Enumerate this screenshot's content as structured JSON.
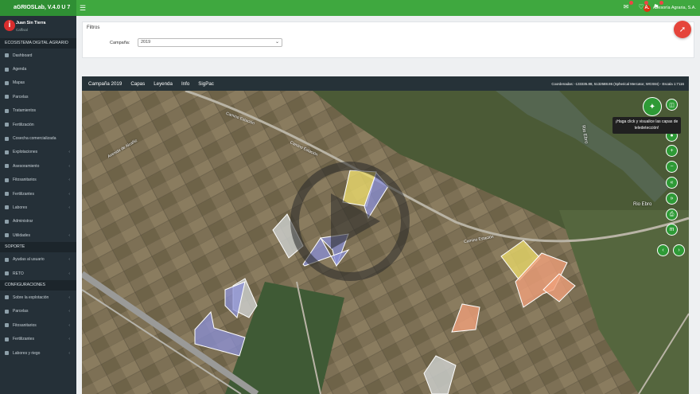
{
  "app": {
    "title": "aGRIOSLab, V.4.0 U 7"
  },
  "topbar": {
    "menu_icon": "hamburger-icon",
    "icons": [
      "mail-icon",
      "bell-icon",
      "flag-icon"
    ],
    "company_logo": "A.",
    "company_name": "Asesoría Agraria, S.A."
  },
  "profile": {
    "name": "Juan Sin Tierra",
    "location": "Caffisal"
  },
  "sidebar": {
    "section1": "ECOSISTEMA DIGITAL AGRARIO",
    "items1": [
      {
        "label": "Dashboard",
        "chev": false
      },
      {
        "label": "Agenda",
        "chev": false
      },
      {
        "label": "Mapas",
        "chev": false
      },
      {
        "label": "Parcelas",
        "chev": false
      },
      {
        "label": "Tratamientos",
        "chev": false
      },
      {
        "label": "Fertilización",
        "chev": false
      },
      {
        "label": "Cosecha comercializada",
        "chev": false
      },
      {
        "label": "Explotaciones",
        "chev": true
      },
      {
        "label": "Asesoramiento",
        "chev": true
      },
      {
        "label": "Fitosanitarios",
        "chev": true
      },
      {
        "label": "Fertilizantes",
        "chev": true
      },
      {
        "label": "Labores",
        "chev": true
      },
      {
        "label": "Administrar",
        "chev": false
      },
      {
        "label": "Utilidades",
        "chev": true
      }
    ],
    "section2": "SOPORTE",
    "items2": [
      {
        "label": "Ayudas al usuario",
        "chev": true
      },
      {
        "label": "RETO",
        "chev": true
      }
    ],
    "section3": "CONFIGURACIONES",
    "items3": [
      {
        "label": "Sobre la explotación",
        "chev": true
      },
      {
        "label": "Parcelas",
        "chev": true
      },
      {
        "label": "Fitosanitarios",
        "chev": true
      },
      {
        "label": "Fertilizantes",
        "chev": true
      },
      {
        "label": "Labores y riego",
        "chev": true
      }
    ]
  },
  "filters": {
    "title": "Filtros",
    "campaign_label": "Campaña:",
    "campaign_value": "2019"
  },
  "map": {
    "toolbar": [
      "Campaña 2019",
      "Capas",
      "Leyenda",
      "Info",
      "SigPac"
    ],
    "coords": "Coordenadas: -133335.88, 5132588.86 (Spherical Mercator, WGS84) - Escala 1:7116",
    "tooltip": "¡Haga click y visualice las capas de teledetección!",
    "labels": [
      "Rio Ebro",
      "Rio Ebro",
      "Avenida de Alcañiz",
      "Camino Estación",
      "Camino Estación",
      "Camino Estación"
    ],
    "colors": {
      "yellow": "#e8d86a",
      "blue": "#8b90d8",
      "orange": "#f0a07a",
      "grey": "#c9cbc9"
    }
  }
}
